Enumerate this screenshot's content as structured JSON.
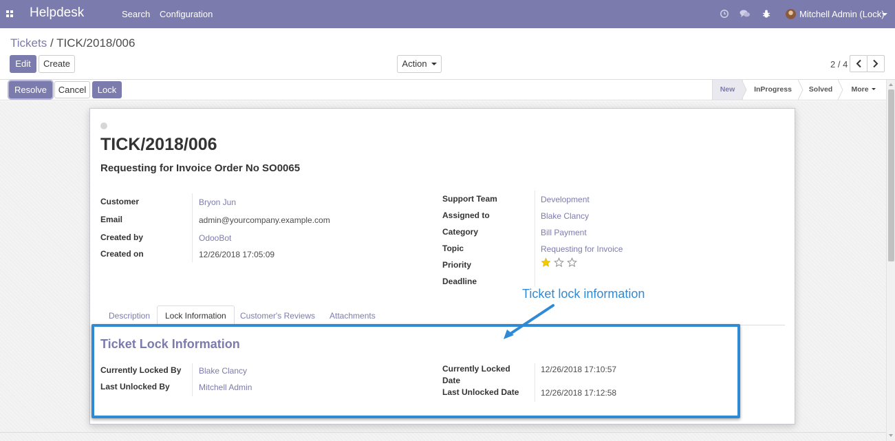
{
  "navbar": {
    "app_name": "Helpdesk",
    "menus": [
      "Search",
      "Configuration"
    ],
    "user_name": "Mitchell Admin (Lock)",
    "icons": [
      "clock-icon",
      "chat-icon",
      "bug-icon"
    ]
  },
  "breadcrumb": {
    "parent": "Tickets",
    "separator": "/",
    "current": "TICK/2018/006"
  },
  "controls": {
    "edit_label": "Edit",
    "create_label": "Create",
    "action_label": "Action",
    "pager_value": "2 / 4"
  },
  "statusbar": {
    "buttons": [
      "Resolve",
      "Cancel",
      "Lock"
    ],
    "stages": [
      "New",
      "InProgress",
      "Solved"
    ],
    "active_stage": "New",
    "more_label": "More"
  },
  "ticket": {
    "number": "TICK/2018/006",
    "subject": "Requesting for Invoice Order No SO0065"
  },
  "left_fields": [
    {
      "label": "Customer",
      "value": "Bryon Jun"
    },
    {
      "label": "Email",
      "value": "admin@yourcompany.example.com"
    },
    {
      "label": "Created by",
      "value": "OdooBot"
    },
    {
      "label": "Created on",
      "value": "12/26/2018 17:05:09"
    }
  ],
  "right_fields": [
    {
      "label": "Support Team",
      "value": "Development"
    },
    {
      "label": "Assigned to",
      "value": "Blake Clancy"
    },
    {
      "label": "Category",
      "value": "Bill Payment"
    },
    {
      "label": "Topic",
      "value": "Requesting for Invoice"
    },
    {
      "label": "Priority",
      "stars_filled": 1,
      "stars_total": 3
    },
    {
      "label": "Deadline",
      "value": ""
    }
  ],
  "tabs": [
    "Description",
    "Lock Information",
    "Customer's Reviews",
    "Attachments"
  ],
  "active_tab": "Lock Information",
  "lock_info": {
    "title": "Ticket Lock Information",
    "left": [
      {
        "label": "Currently Locked By",
        "value": "Blake Clancy"
      },
      {
        "label": "Last Unlocked By",
        "value": "Mitchell Admin"
      }
    ],
    "right": [
      {
        "label_line1": "Currently Locked",
        "label_line2": "Date",
        "value": "12/26/2018 17:10:57"
      },
      {
        "label": "Last Unlocked Date",
        "value": "12/26/2018 17:12:58"
      }
    ]
  },
  "annotation": {
    "text": "Ticket lock information",
    "color": "#2f8ad6"
  },
  "colors": {
    "brand": "#7c7bad",
    "annotation": "#2f8ad6",
    "star": "#f3cc00"
  }
}
